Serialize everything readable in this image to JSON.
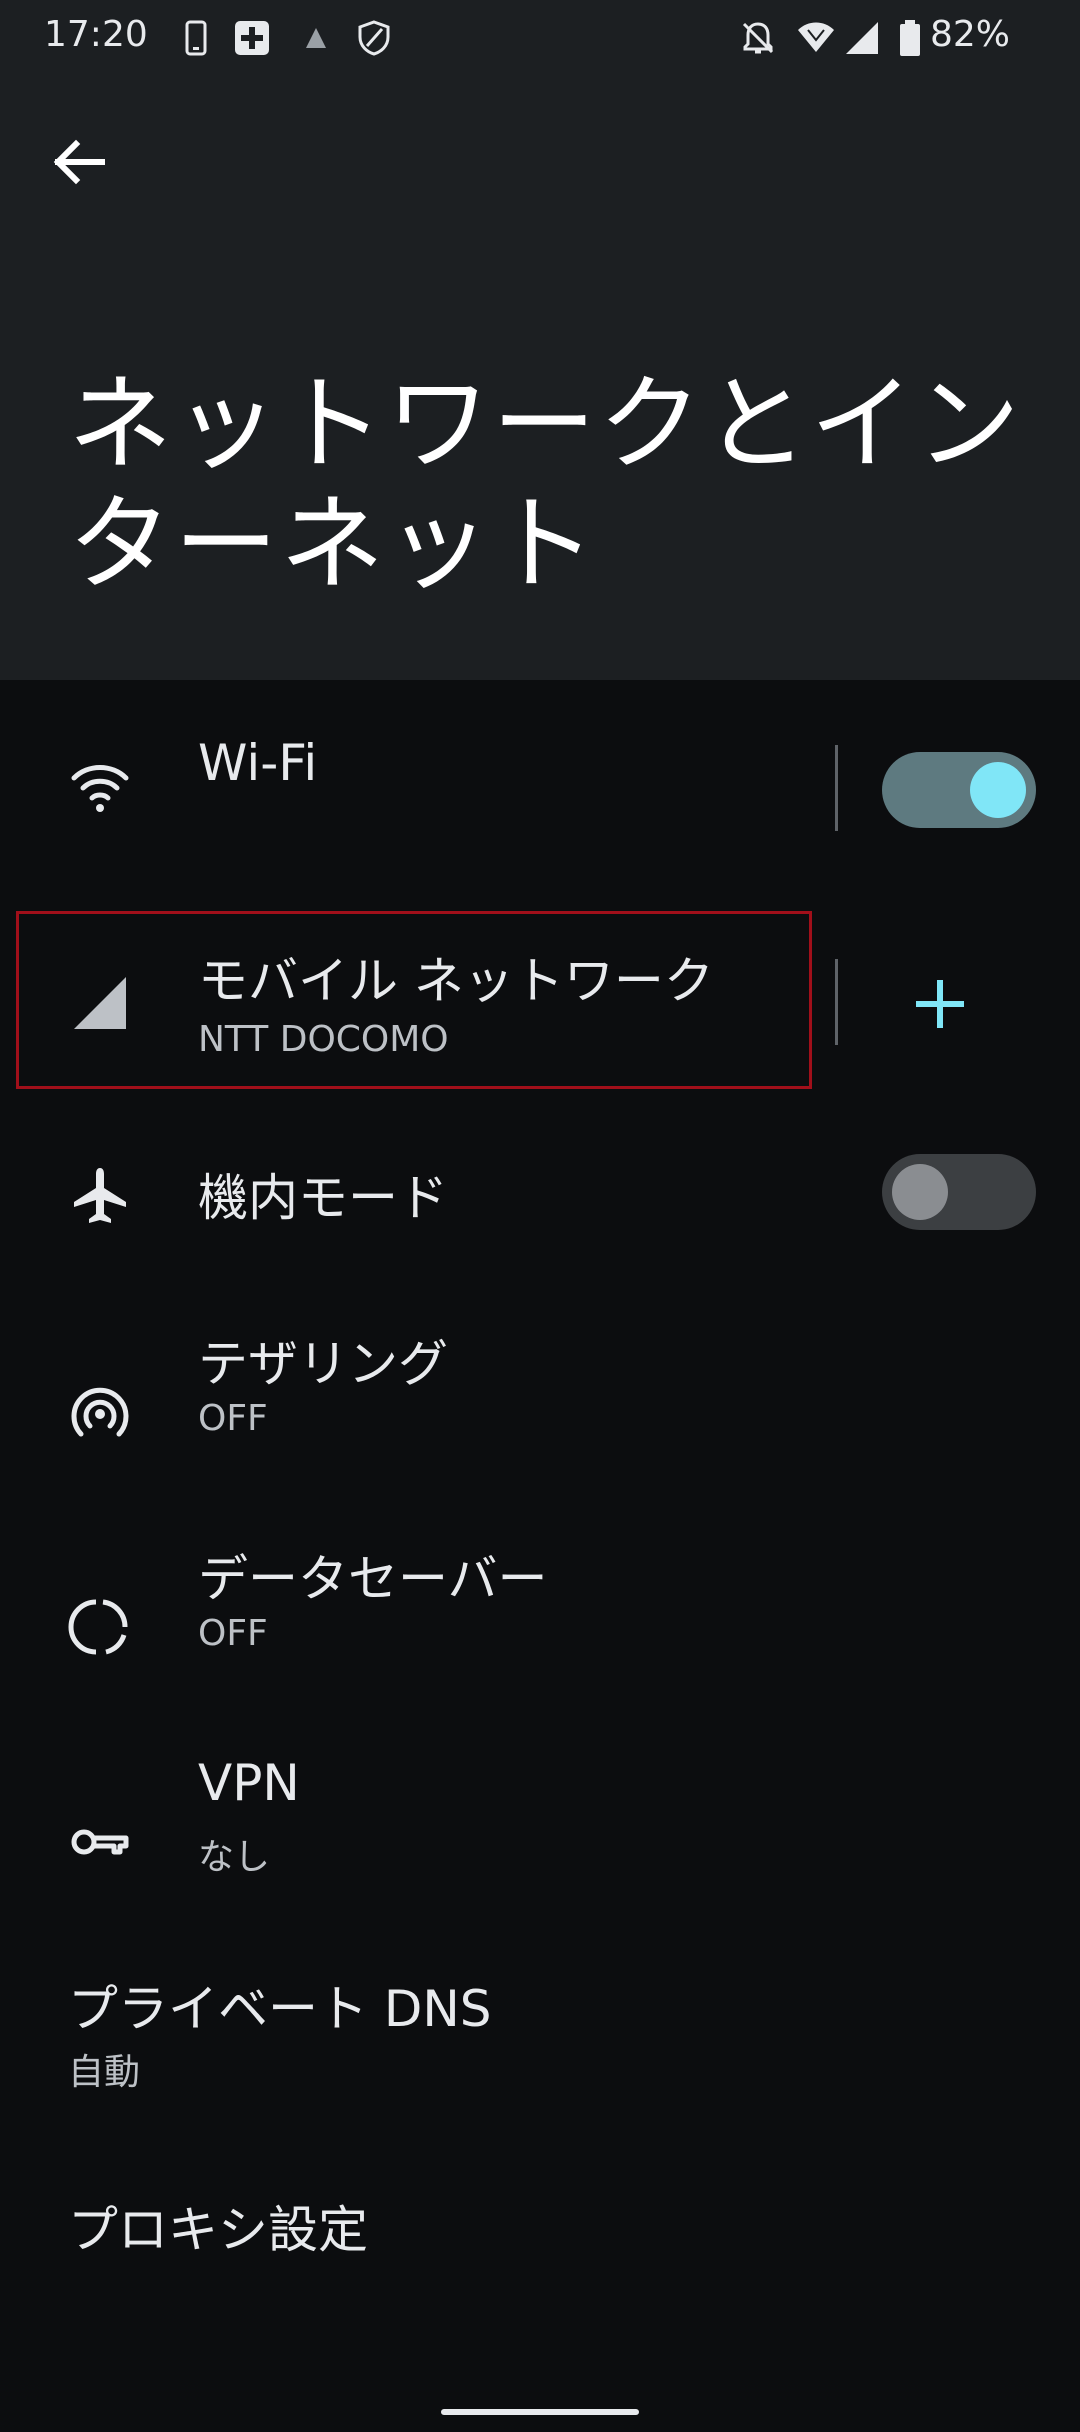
{
  "status_bar": {
    "time": "17:20",
    "battery": "82%",
    "left_icons": [
      "phone-icon",
      "medical-plus-icon",
      "warning-icon",
      "shield-icon"
    ],
    "right_icons": [
      "bell-off-icon",
      "wifi-icon",
      "signal-icon",
      "battery-icon"
    ]
  },
  "header": {
    "back_label": "",
    "title": "ネットワークとインターネット"
  },
  "items": {
    "wifi": {
      "title": "Wi-Fi",
      "icon": "wifi-icon",
      "toggle": true
    },
    "mobile": {
      "title": "モバイル ネットワーク",
      "subtitle": "NTT DOCOMO",
      "icon": "signal-icon",
      "action_icon": "plus-icon"
    },
    "airplane": {
      "title": "機内モード",
      "icon": "airplane-icon",
      "toggle": false
    },
    "tethering": {
      "title": "テザリング",
      "subtitle": "OFF",
      "icon": "hotspot-icon"
    },
    "datasaver": {
      "title": "データセーバー",
      "subtitle": "OFF",
      "icon": "data-saver-icon"
    },
    "vpn": {
      "title": "VPN",
      "subtitle": "なし",
      "icon": "key-icon"
    },
    "private_dns": {
      "title": "プライベート DNS",
      "subtitle": "自動"
    },
    "proxy": {
      "title": "プロキシ設定"
    }
  },
  "colors": {
    "background": "#0c0d0f",
    "header_bg": "#1c1f22",
    "accent": "#80e6f7",
    "highlight": "#a10f1a"
  }
}
